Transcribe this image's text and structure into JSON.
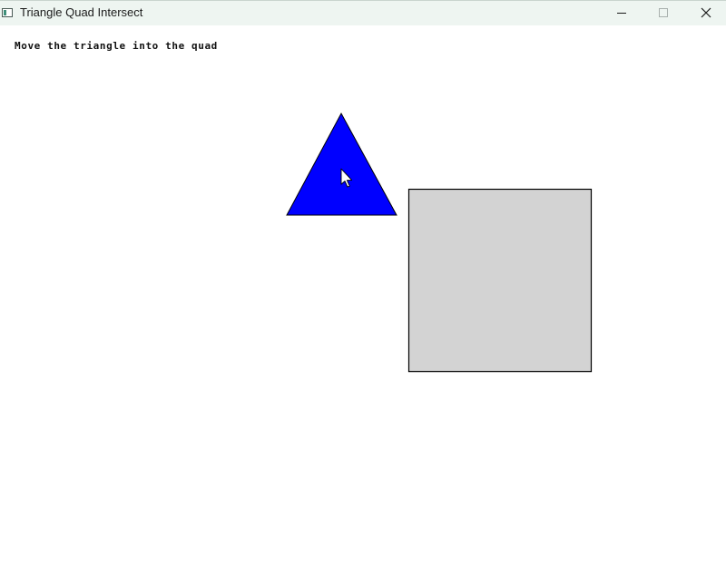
{
  "window": {
    "title": "Triangle Quad Intersect"
  },
  "content": {
    "instruction": "Move the triangle into the quad"
  },
  "icons": {
    "app": "app-window-icon",
    "minimize": "minimize-icon",
    "maximize": "maximize-icon",
    "close": "close-icon",
    "cursor": "mouse-pointer-icon"
  },
  "colors": {
    "triangle_fill": "#0000ff",
    "quad_fill": "#d3d3d3",
    "outline": "#000000",
    "titlebar_bg": "#eef5f1"
  }
}
